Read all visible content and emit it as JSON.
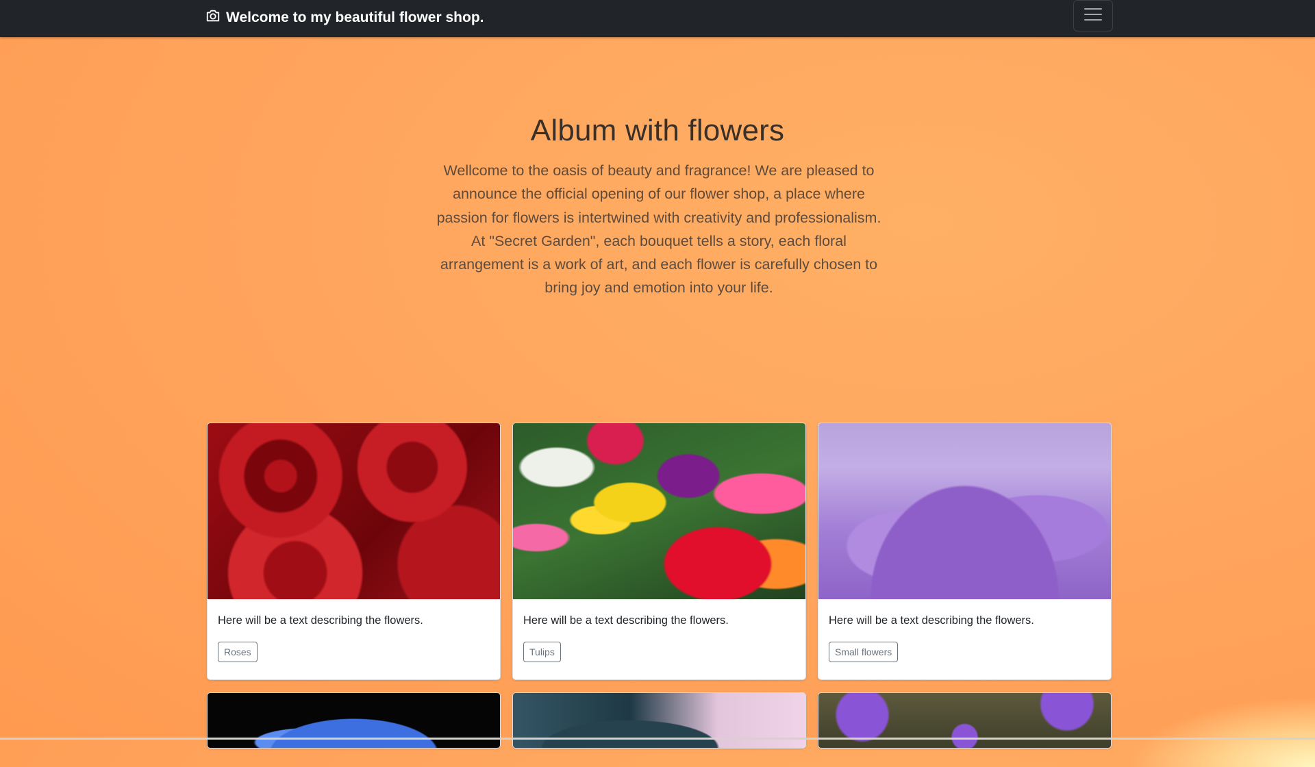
{
  "navbar": {
    "brand_text": "Welcome to my beautiful flower shop.",
    "brand_icon": "camera-icon",
    "toggler_icon": "hamburger-menu-icon",
    "background_color": "#212529"
  },
  "hero": {
    "title": "Album with flowers",
    "text": "Wellcome to the oasis of beauty and fragrance! We are pleased to announce the official opening of our flower shop, a place where passion for flowers is intertwined with creativity and professionalism. At \"Secret Garden\", each bouquet tells a story, each floral arrangement is a work of art, and each flower is carefully chosen to bring joy and emotion into your life."
  },
  "cards": [
    {
      "image": "red-roses-image",
      "text": "Here will be a text describing the flowers.",
      "button": "Roses"
    },
    {
      "image": "tulips-image",
      "text": "Here will be a text describing the flowers.",
      "button": "Tulips"
    },
    {
      "image": "crocus-field-image",
      "text": "Here will be a text describing the flowers.",
      "button": "Small flowers"
    }
  ],
  "partial_cards": [
    {
      "image": "blue-hydrangea-image"
    },
    {
      "image": "blue-rose-image"
    },
    {
      "image": "purple-asters-image"
    }
  ],
  "colors": {
    "page_background": "#ffa55e",
    "button_outline": "#6c757d"
  }
}
